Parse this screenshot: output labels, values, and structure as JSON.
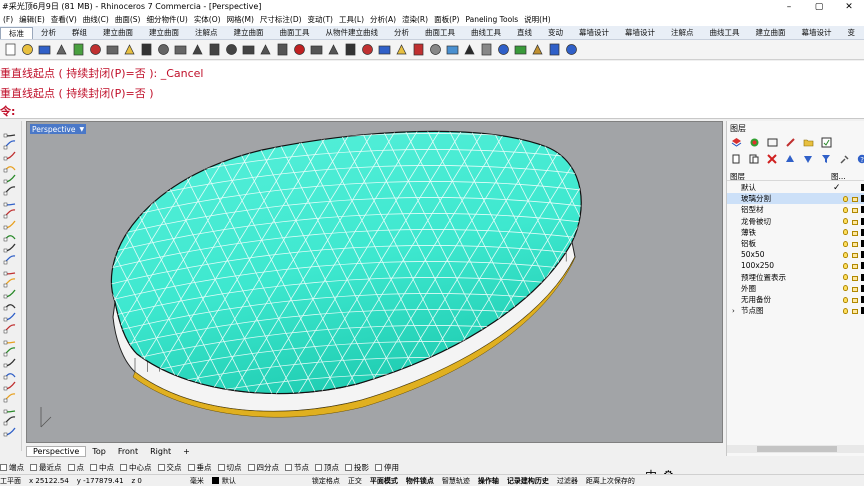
{
  "window": {
    "title": "#采光顶6月9日 (81 MB) - Rhinoceros 7 Commercia - [Perspective]",
    "buttons": [
      "–",
      "▢",
      "✕"
    ]
  },
  "menu": [
    "(F)",
    "编辑(E)",
    "查看(V)",
    "曲线(C)",
    "曲面(S)",
    "细分物件(U)",
    "实体(O)",
    "网格(M)",
    "尺寸标注(D)",
    "变动(T)",
    "工具(L)",
    "分析(A)",
    "渲染(R)",
    "面板(P)",
    "Paneling Tools",
    "说明(H)"
  ],
  "tabs": [
    "标准",
    "分析",
    "群组",
    "建立曲面",
    "建立曲面",
    "注解点",
    "建立曲面",
    "曲面工具",
    "从物件建立曲线",
    "分析",
    "曲面工具",
    "曲线工具",
    "直线",
    "变动",
    "幕墙设计",
    "幕墙设计",
    "注解点",
    "曲线工具",
    "建立曲面",
    "幕墙设计",
    "变"
  ],
  "command_history": {
    "line1": "重直线起点 ( 持续封闭(P)=否 ): _Cancel",
    "line2": "重直线起点 ( 持续封闭(P)=否 )",
    "prompt": "令:"
  },
  "viewport": {
    "label": "Perspective",
    "tabs": [
      "Perspective",
      "Top",
      "Front",
      "Right",
      "+"
    ],
    "active_tab": "Perspective"
  },
  "layers_panel": {
    "title": "图层",
    "header_col": "图...",
    "layers": [
      {
        "name": "默认",
        "current": true
      },
      {
        "name": "玻璃分割",
        "selected": true
      },
      {
        "name": "铝型材"
      },
      {
        "name": "龙骨被切"
      },
      {
        "name": "薄铁"
      },
      {
        "name": "铝板"
      },
      {
        "name": "50x50"
      },
      {
        "name": "100x250"
      },
      {
        "name": "预埋位置表示"
      },
      {
        "name": "外圈"
      },
      {
        "name": "无用备份"
      },
      {
        "name": "节点图",
        "collapsed": true
      }
    ]
  },
  "osnap": [
    "端点",
    "最近点",
    "点",
    "中点",
    "中心点",
    "交点",
    "垂点",
    "切点",
    "四分点",
    "节点",
    "顶点",
    "投影",
    "停用"
  ],
  "status": {
    "cplane": "工平面",
    "x": "x 25122.54",
    "y": "y -177879.41",
    "z": "z 0",
    "unit": "毫米",
    "layer": "默认",
    "items": [
      "锁定格点",
      "正交",
      "平面模式",
      "物件锁点",
      "智慧轨迹",
      "操作轴",
      "记录建构历史",
      "过滤器",
      "距离上次保存的"
    ],
    "ime": "中"
  },
  "colors": {
    "accent": "#4a78c8",
    "command_red": "#c0102a",
    "dome_fill": "#3ee8cf",
    "viewport_bg": "#a2a4a7"
  }
}
